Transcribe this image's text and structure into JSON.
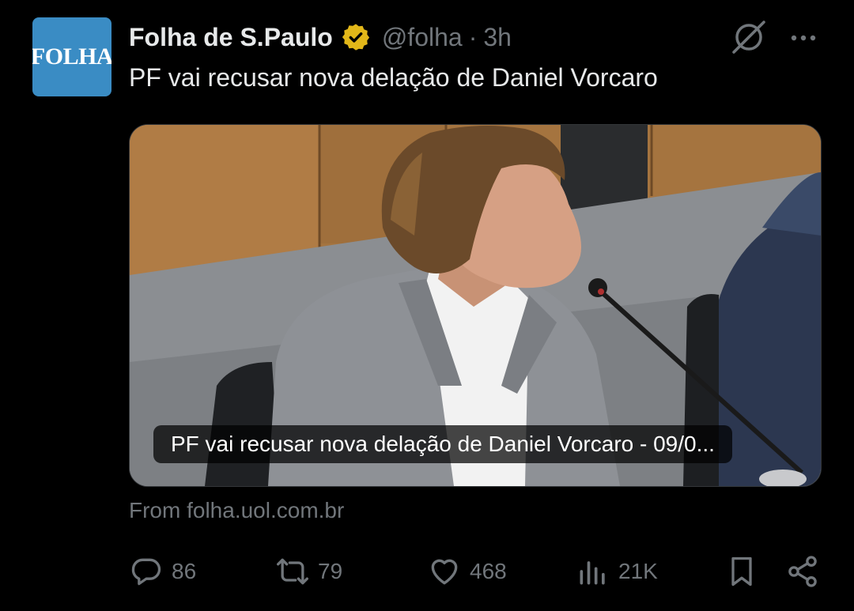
{
  "author": {
    "avatar_text": "FOLHA",
    "display_name": "Folha de S.Paulo",
    "handle": "@folha",
    "separator": "·",
    "time": "3h"
  },
  "tweet": {
    "text": "PF vai recusar nova delação de Daniel Vorcaro"
  },
  "card": {
    "caption": "PF vai recusar nova delação de Daniel Vorcaro - 09/0...",
    "source": "From folha.uol.com.br"
  },
  "actions": {
    "replies": "86",
    "reposts": "79",
    "likes": "468",
    "views": "21K"
  },
  "colors": {
    "background": "#000000",
    "text_primary": "#e7e9ea",
    "text_secondary": "#71767b",
    "verified_gold": "#e2b719",
    "avatar_blue": "#3a8cc4"
  },
  "icons": {
    "verified": "verified-badge-icon",
    "grok": "grok-icon",
    "more": "more-options-icon",
    "reply": "reply-icon",
    "repost": "repost-icon",
    "like": "heart-icon",
    "views": "views-icon",
    "bookmark": "bookmark-icon",
    "share": "share-icon"
  }
}
